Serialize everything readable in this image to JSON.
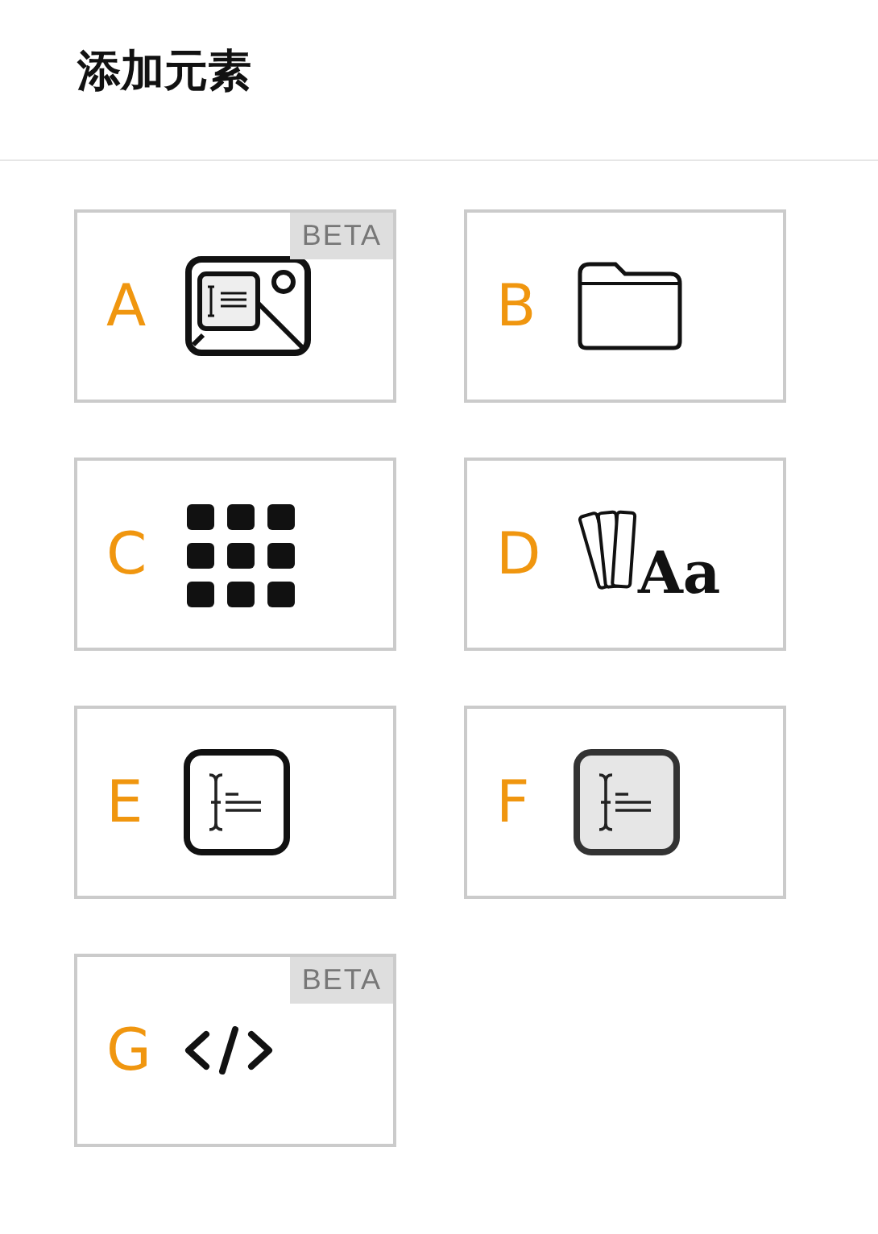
{
  "header": {
    "title": "添加元素"
  },
  "elements": [
    {
      "letter": "A",
      "kind": "media",
      "badge": "BETA"
    },
    {
      "letter": "B",
      "kind": "folder"
    },
    {
      "letter": "C",
      "kind": "grid"
    },
    {
      "letter": "D",
      "kind": "font",
      "glyph": "Aa"
    },
    {
      "letter": "E",
      "kind": "field"
    },
    {
      "letter": "F",
      "kind": "filled"
    },
    {
      "letter": "G",
      "kind": "code",
      "badge": "BETA"
    }
  ]
}
